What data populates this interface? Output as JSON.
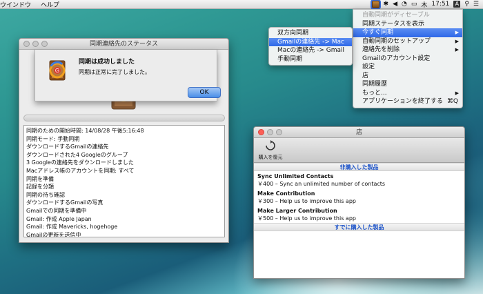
{
  "menubar": {
    "items": [
      "ウインドウ",
      "ヘルプ"
    ],
    "right": {
      "day": "木",
      "time": "17:51",
      "input_source": "A"
    }
  },
  "status_window": {
    "title": "同期連絡先のステータス",
    "alert": {
      "title": "同期は成功しました",
      "message": "同期は正常に完了しました。",
      "ok_label": "OK"
    },
    "log_lines": [
      "同期のための開始時間: 14/08/28 午後5:16:48",
      "同期モード: 手動同期",
      "ダウンロードするGmailの連絡先",
      "ダウンロードされた4 Googleのグループ",
      "3 Googleの連絡先をダウンロードしました",
      "Macアドレス帳のアカウントを同期: すべて",
      "同期を準備",
      "記録を分類",
      "同期の待ち確認",
      "ダウンロードするGmailの写真",
      "Gmailでの同期を準備中",
      "Gmail: 作成 Apple Japan",
      "Gmail: 作成 Mavericks, hogehoge",
      "Gmailの更新を送信中"
    ]
  },
  "store_window": {
    "title": "店",
    "restore_label": "購入を復元",
    "unpurchased_header": "非購入した製品",
    "purchased_header": "すでに購入した製品",
    "products": [
      {
        "name": "Sync Unlimited Contacts",
        "desc": "￥400 – Sync an unlimited number of contacts"
      },
      {
        "name": "Make Contribution",
        "desc": "￥300 – Help us to improve this app"
      },
      {
        "name": "Make Larger Contribution",
        "desc": "￥500 – Help us to improve this app"
      }
    ]
  },
  "app_menu": {
    "auto_sync_disabled": "自動同期がディセーブル",
    "show_status": "同期ステータスを表示",
    "sync_now": "今すぐ同期",
    "auto_sync_setup": "自動同期のセットアップ",
    "delete_contacts": "連絡先を削除",
    "gmail_account": "Gmailのアカウント設定",
    "settings": "設定",
    "store": "店",
    "history": "同期履歴",
    "more": "もっと...",
    "quit": "アプリケーションを終了する",
    "quit_shortcut": "⌘Q"
  },
  "sync_submenu": {
    "two_way": "双方向同期",
    "gmail_to_mac": "Gmailの連絡先 -> Mac",
    "mac_to_gmail": "Macの連絡先 -> Gmail",
    "manual": "手動同期"
  },
  "colors": {
    "highlight": "#2e68e8",
    "section_header_text": "#1f55c9",
    "close_button": "#fc5f57"
  }
}
